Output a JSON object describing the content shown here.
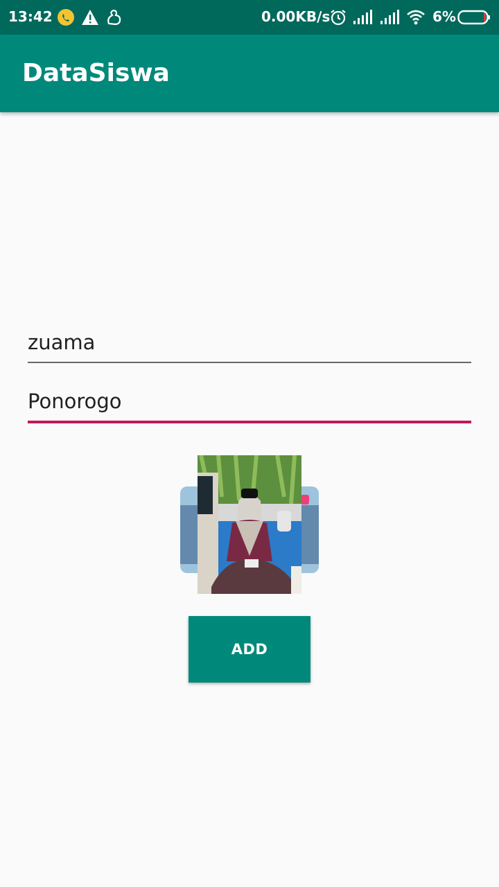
{
  "status_bar": {
    "time": "13:42",
    "network_speed": "0.00KB/s",
    "battery_percent": "6%",
    "icons": [
      "whatsapp-icon",
      "warning-icon",
      "uc-browser-icon",
      "alarm-icon",
      "signal-icon",
      "signal-icon",
      "wifi-icon",
      "battery-icon"
    ]
  },
  "app_bar": {
    "title": "DataSiswa"
  },
  "form": {
    "name_value": "zuama",
    "address_value": "Ponorogo",
    "add_button_label": "ADD"
  },
  "colors": {
    "primary": "#00897b",
    "primary_dark": "#00695c",
    "accent": "#c2185b"
  }
}
